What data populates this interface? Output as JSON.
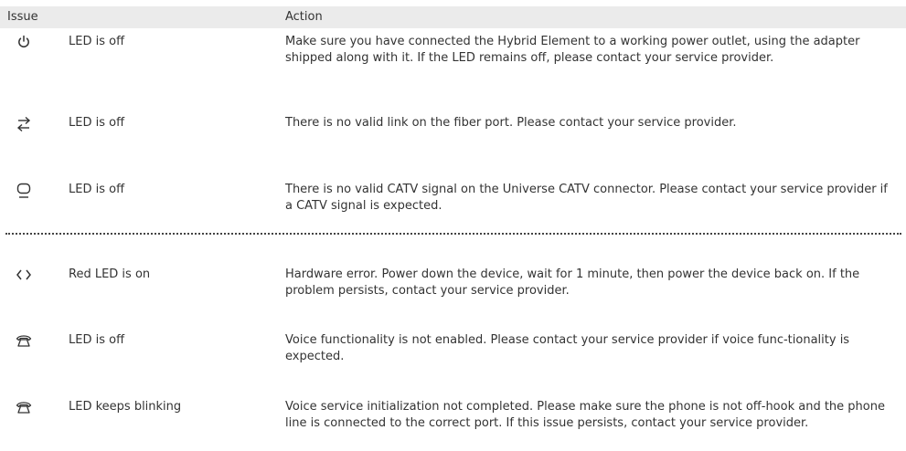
{
  "table": {
    "header": {
      "issue": "Issue",
      "action": "Action"
    },
    "rows": [
      {
        "icon": "power-icon",
        "issue": "LED is off",
        "action": "Make sure you have connected the Hybrid Element to a working power outlet, using the adapter shipped along with it. If the LED remains off, please contact your service provider."
      },
      {
        "icon": "fiber-link-icon",
        "issue": "LED is off",
        "action": "There is no valid link on the fiber port. Please contact your service provider."
      },
      {
        "icon": "catv-icon",
        "issue": "LED is off",
        "action": "There is no valid CATV signal on the Universe CATV connector. Please contact your service provider if a CATV signal is expected."
      },
      {
        "icon": "hardware-icon",
        "issue": "Red LED is on",
        "action": "Hardware error. Power down the device, wait for 1 minute, then power the device back on. If the problem persists, contact your service provider."
      },
      {
        "icon": "phone-icon",
        "issue": "LED is off",
        "action": "Voice functionality is not enabled. Please contact your service provider if voice func-tionality is expected."
      },
      {
        "icon": "phone-icon",
        "issue": "LED keeps blinking",
        "action": "Voice service initialization not completed. Please make sure the phone is not off-hook and the phone line is connected to the correct port. If this issue persists, contact your service provider."
      }
    ]
  }
}
